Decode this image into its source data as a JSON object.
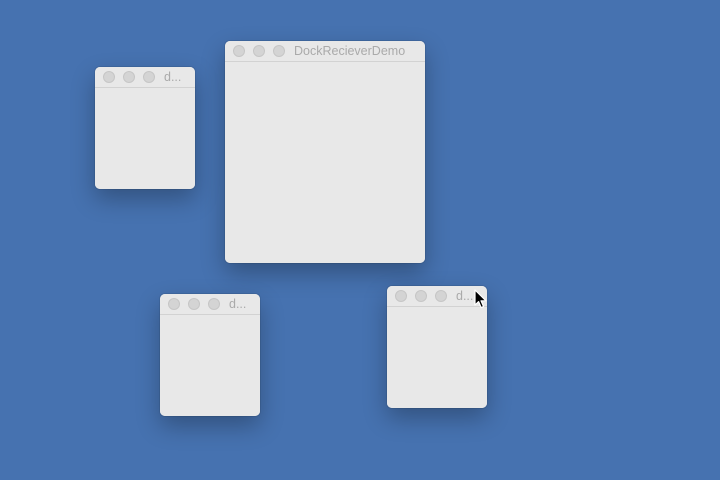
{
  "desktop": {
    "background_color": "#4672b0"
  },
  "windows": [
    {
      "title": "d..."
    },
    {
      "title": "DockRecieverDemo"
    },
    {
      "title": "d..."
    },
    {
      "title": "d..."
    }
  ],
  "cursor": {
    "icon": "arrow-pointer-icon"
  }
}
